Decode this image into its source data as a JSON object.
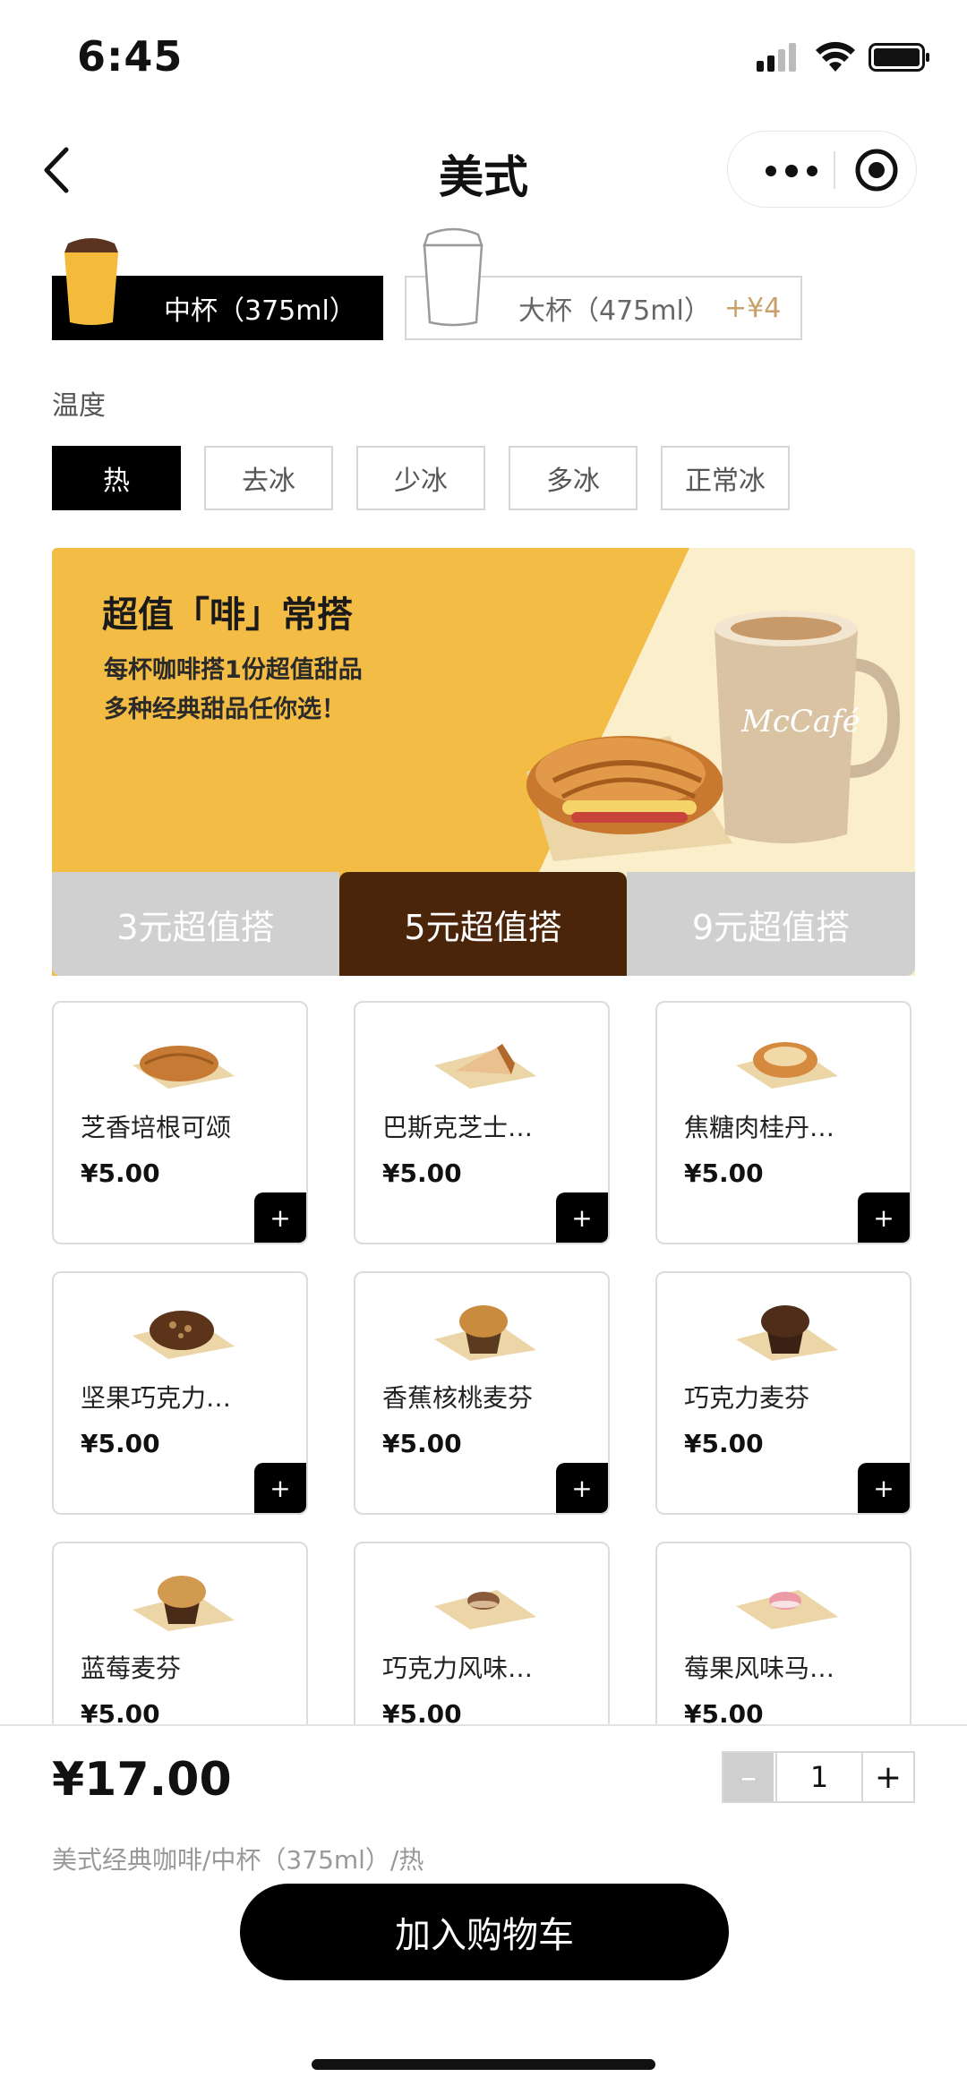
{
  "status_bar": {
    "time": "6:45"
  },
  "header": {
    "title": "美式"
  },
  "sizes": [
    {
      "label": "中杯（375ml）",
      "extra": "",
      "selected": true
    },
    {
      "label": "大杯（475ml）",
      "extra": "+¥4",
      "selected": false
    }
  ],
  "temperature": {
    "label": "温度",
    "options": [
      "热",
      "去冰",
      "少冰",
      "多冰",
      "正常冰"
    ],
    "selected": "热"
  },
  "promo": {
    "title": "超值「啡」常搭",
    "line1": "每杯咖啡搭1份超值甜品",
    "line2": "多种经典甜品任你选！",
    "mug_brand": "McCafé"
  },
  "tabs": [
    {
      "label": "3元超值搭",
      "selected": false
    },
    {
      "label": "5元超值搭",
      "selected": true
    },
    {
      "label": "9元超值搭",
      "selected": false
    }
  ],
  "products": [
    {
      "name": "芝香培根可颂",
      "price": "¥5.00",
      "add": "+"
    },
    {
      "name": "巴斯克芝士…",
      "price": "¥5.00",
      "add": "+"
    },
    {
      "name": "焦糖肉桂丹…",
      "price": "¥5.00",
      "add": "+"
    },
    {
      "name": "坚果巧克力…",
      "price": "¥5.00",
      "add": "+"
    },
    {
      "name": "香蕉核桃麦芬",
      "price": "¥5.00",
      "add": "+"
    },
    {
      "name": "巧克力麦芬",
      "price": "¥5.00",
      "add": "+"
    },
    {
      "name": "蓝莓麦芬",
      "price": "¥5.00",
      "add": "+"
    },
    {
      "name": "巧克力风味…",
      "price": "¥5.00",
      "add": "+"
    },
    {
      "name": "莓果风味马…",
      "price": "¥5.00",
      "add": "+"
    }
  ],
  "bottom": {
    "total": "¥17.00",
    "quantity": "1",
    "minus": "–",
    "plus": "+",
    "summary": "美式经典咖啡/中杯（375ml）/热",
    "add_to_cart": "加入购物车"
  },
  "colors": {
    "accent_dark_brown": "#4a2509",
    "promo_yellow": "#f2bc45",
    "extra_price_gold": "#c7a06a"
  }
}
